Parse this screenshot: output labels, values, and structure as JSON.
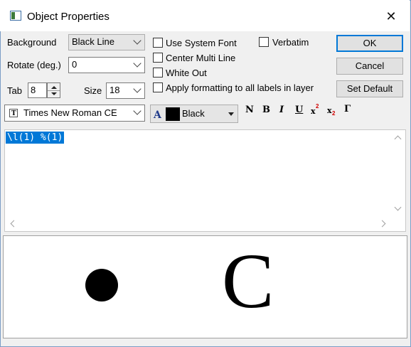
{
  "window": {
    "title": "Object Properties"
  },
  "fields": {
    "background_label": "Background",
    "background_value": "Black Line",
    "rotate_label": "Rotate (deg.)",
    "rotate_value": "0",
    "tab_label": "Tab",
    "tab_value": "8",
    "size_label": "Size",
    "size_value": "18",
    "font_value": "Times New Roman CE",
    "color_value": "Black"
  },
  "checkboxes": {
    "use_system_font": "Use System Font",
    "verbatim": "Verbatim",
    "center_multi_line": "Center Multi Line",
    "white_out": "White Out",
    "apply_formatting": "Apply formatting to all labels in layer"
  },
  "buttons": {
    "ok": "OK",
    "cancel": "Cancel",
    "set_default": "Set Default"
  },
  "format_buttons": {
    "normal": "N",
    "bold": "B",
    "italic": "I",
    "underline": "U",
    "superscript_base": "x",
    "superscript_mark": "2",
    "subscript_base": "x",
    "subscript_mark": "2",
    "greek": "Γ"
  },
  "editor": {
    "text": "\\l(1) %(1)"
  },
  "preview": {
    "letter": "C"
  },
  "colors": {
    "selection": "#0078d7",
    "accent_blue": "#0078d7",
    "swatch": "#000000"
  }
}
